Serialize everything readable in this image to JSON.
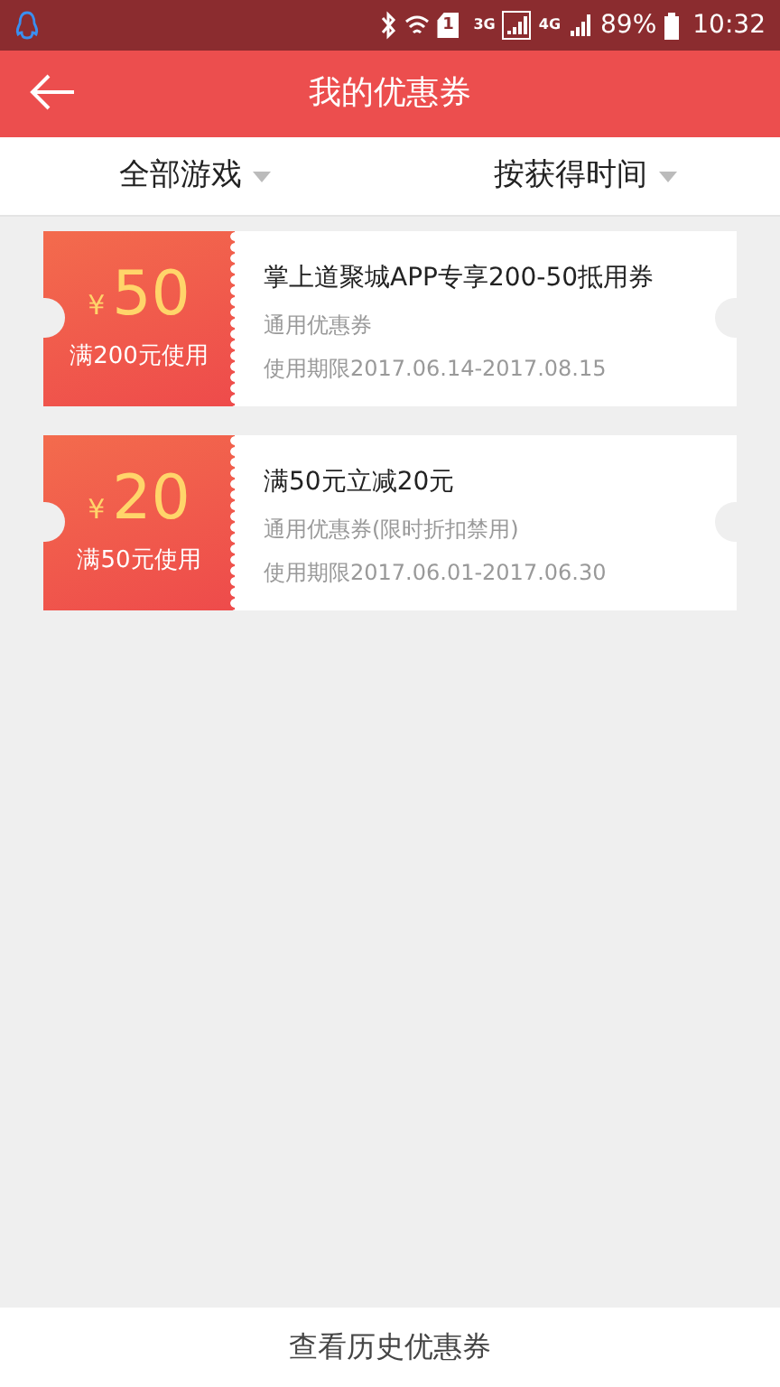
{
  "status_bar": {
    "sim_label": "1",
    "network_1": "3G",
    "network_2": "4G",
    "battery": "89%",
    "time": "10:32"
  },
  "header": {
    "title": "我的优惠券"
  },
  "filters": [
    {
      "label": "全部游戏"
    },
    {
      "label": "按获得时间"
    }
  ],
  "coupons": [
    {
      "currency": "¥",
      "amount": "50",
      "condition": "满200元使用",
      "title": "掌上道聚城APP专享200-50抵用券",
      "type": "通用优惠券",
      "validity": "使用期限2017.06.14-2017.08.15"
    },
    {
      "currency": "¥",
      "amount": "20",
      "condition": "满50元使用",
      "title": "满50元立减20元",
      "type": "通用优惠券(限时折扣禁用)",
      "validity": "使用期限2017.06.01-2017.06.30"
    }
  ],
  "footer": {
    "label": "查看历史优惠券"
  }
}
